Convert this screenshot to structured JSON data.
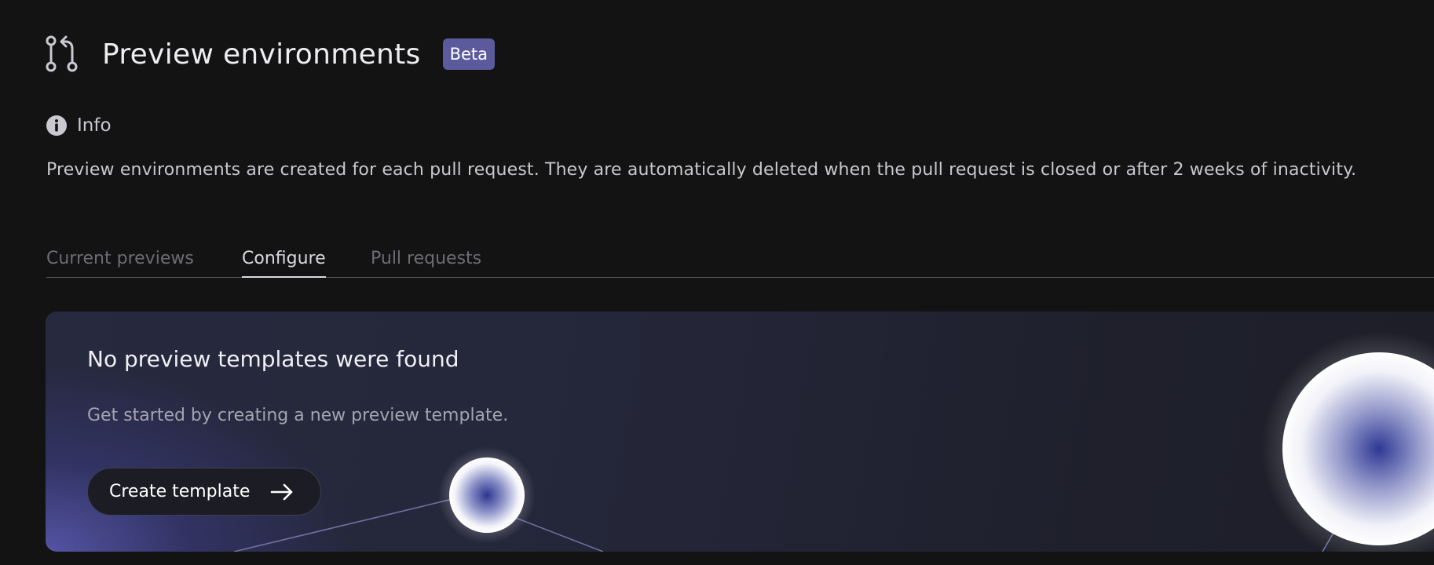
{
  "header": {
    "icon": "git-pull-request-icon",
    "title": "Preview environments",
    "badge": "Beta"
  },
  "info": {
    "icon": "info-icon",
    "label": "Info",
    "description": "Preview environments are created for each pull request. They are automatically deleted when the pull request is closed or after 2 weeks of inactivity."
  },
  "tabs": [
    {
      "label": "Current previews",
      "active": false
    },
    {
      "label": "Configure",
      "active": true
    },
    {
      "label": "Pull requests",
      "active": false
    }
  ],
  "empty_state": {
    "title": "No preview templates were found",
    "subtitle": "Get started by creating a new preview template.",
    "button_label": "Create template",
    "button_icon": "arrow-right-icon"
  },
  "colors": {
    "background": "#131313",
    "badge": "#5a5a9c",
    "accent": "#4a4aa0"
  }
}
